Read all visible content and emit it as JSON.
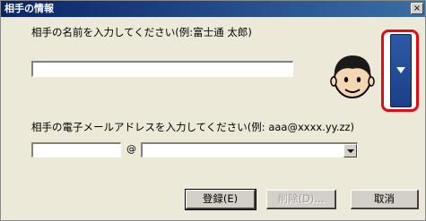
{
  "window": {
    "title": "相手の情報",
    "close_label": "×"
  },
  "name_section": {
    "label": "相手の名前を入力してください(例:富士通 太郎)",
    "value": ""
  },
  "email_section": {
    "label": "相手の電子メールアドレスを入力してください(例: aaa@xxxx.yy.zz)",
    "user_value": "",
    "at_sign": "@",
    "domain_value": ""
  },
  "avatar": {
    "icon": "face-avatar-icon",
    "select_icon": "chevron-down-icon"
  },
  "buttons": {
    "register": "登録(E)",
    "delete": "削除(D)...",
    "cancel": "取消"
  },
  "colors": {
    "highlight": "#e30b17",
    "select_button": "#1b3f86"
  }
}
